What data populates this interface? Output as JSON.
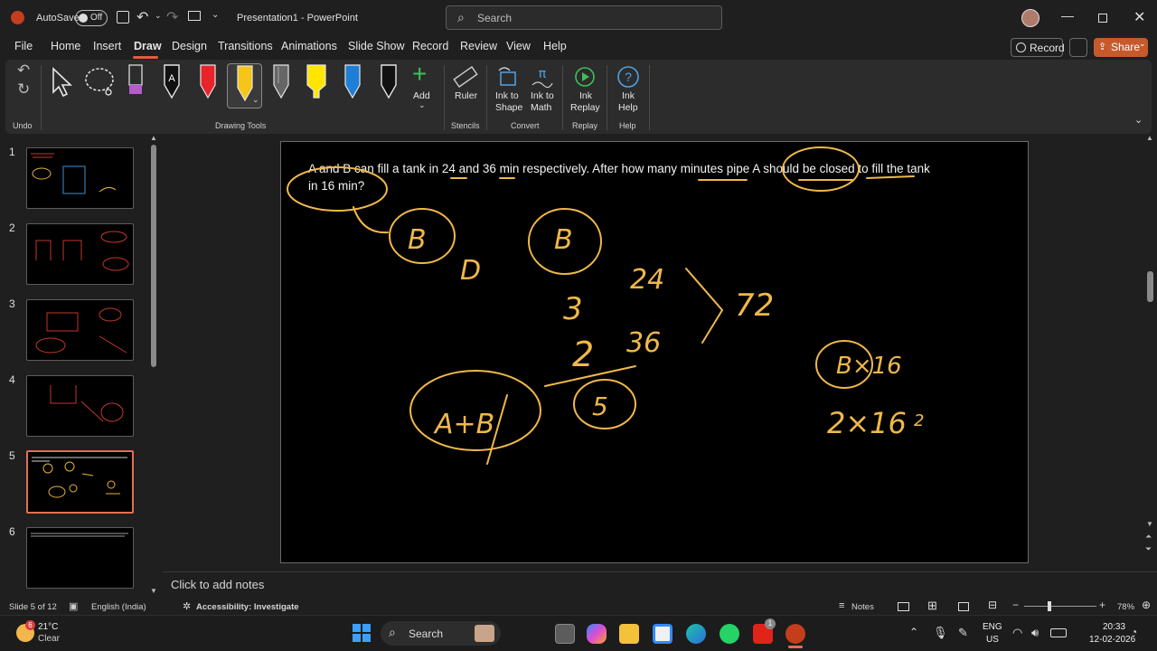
{
  "titlebar": {
    "autosave_label": "AutoSave",
    "autosave_state": "Off",
    "doc_title": "Presentation1",
    "app_separator": " - ",
    "app_name": "PowerPoint",
    "search_placeholder": "Search"
  },
  "menu": {
    "items": [
      "File",
      "Home",
      "Insert",
      "Draw",
      "Design",
      "Transitions",
      "Animations",
      "Slide Show",
      "Record",
      "Review",
      "View",
      "Help"
    ],
    "active": "Draw",
    "record_label": "Record",
    "share_label": "Share"
  },
  "ribbon": {
    "groups": {
      "undo": "Undo",
      "drawing_tools": "Drawing Tools",
      "stencils": "Stencils",
      "convert": "Convert",
      "replay": "Replay",
      "help": "Help"
    },
    "add_label": "Add",
    "ruler_label": "Ruler",
    "ink_to_shape": [
      "Ink to",
      "Shape"
    ],
    "ink_to_math": [
      "Ink to",
      "Math"
    ],
    "ink_replay": [
      "Ink",
      "Replay"
    ],
    "ink_help": [
      "Ink",
      "Help"
    ],
    "colors": {
      "purple_pen": "#b45cc9",
      "red_pen": "#e8232a",
      "yellow_pen": "#f5c518",
      "yellow_highlighter": "#ffe500",
      "blue_pen": "#1e7fd6",
      "white_pen": "#ffffff",
      "accent": "#e65a3f",
      "add_green": "#3fbf5a"
    }
  },
  "slides": {
    "numbers": [
      "1",
      "2",
      "3",
      "4",
      "5",
      "6"
    ],
    "selected": "5"
  },
  "slide": {
    "question_line1": "A and B can fill a tank in 24 and 36 min respectively. After how many minutes pipe A should be closed to fill the tank",
    "question_line2": "in 16 min?",
    "ink": {
      "b1": "B",
      "b2": "B",
      "d": "D",
      "n24": "24",
      "n72": "72",
      "n3": "3",
      "n2": "2",
      "n36": "36",
      "n5": "5",
      "apb": "A+B",
      "bx16": "B×16",
      "expr": "2×16",
      "expr_tail": "2"
    }
  },
  "notes_placeholder": "Click to add notes",
  "status": {
    "slide_of": "Slide 5 of 12",
    "language": "English (India)",
    "accessibility": "Accessibility: Investigate",
    "notes": "Notes",
    "zoom": "78%"
  },
  "taskbar": {
    "weather_temp": "21°C",
    "weather_cond": "Clear",
    "weather_badge": "6",
    "search_label": "Search",
    "lang1": "ENG",
    "lang2": "US",
    "time": "20:33",
    "date": "12-02-2026",
    "app_badge": "1"
  }
}
